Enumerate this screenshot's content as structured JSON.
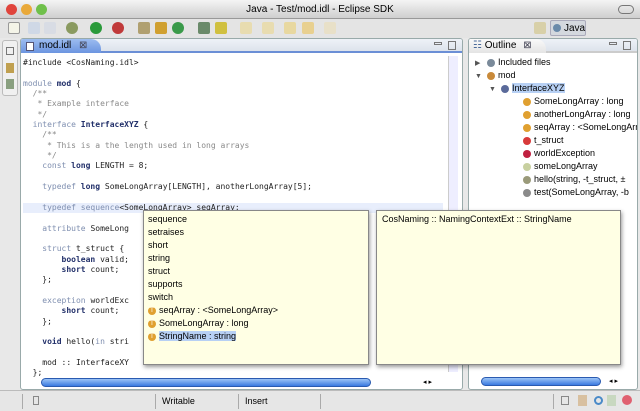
{
  "window": {
    "title": "Java - Test/mod.idl - Eclipse SDK"
  },
  "perspective": {
    "label": "Java"
  },
  "editor": {
    "tab_label": "mod.idl",
    "lines": [
      [
        [
          "",
          "#include <CosNaming.idl>"
        ]
      ],
      [],
      [
        [
          "kw",
          "module"
        ],
        [
          "bd",
          " mod"
        ],
        [
          "",
          " {"
        ]
      ],
      [
        [
          "cm",
          "  /**"
        ]
      ],
      [
        [
          "cm",
          "   * Example interface"
        ]
      ],
      [
        [
          "cm",
          "   */"
        ]
      ],
      [
        [
          "kw",
          "  interface"
        ],
        [
          "bd",
          " InterfaceXYZ"
        ],
        [
          "",
          " {"
        ]
      ],
      [
        [
          "cm",
          "    /**"
        ]
      ],
      [
        [
          "cm",
          "     * This is a the length used in long arrays"
        ]
      ],
      [
        [
          "cm",
          "     */"
        ]
      ],
      [
        [
          "kw",
          "    const"
        ],
        [
          "bd",
          " long"
        ],
        [
          "",
          " LENGTH = 8;"
        ]
      ],
      [],
      [
        [
          "kw",
          "    typedef"
        ],
        [
          "bd",
          " long"
        ],
        [
          "",
          " SomeLongArray[LENGTH], anotherLongArray[5];"
        ]
      ],
      [],
      [
        [
          "kw",
          "    typedef sequence"
        ],
        [
          "",
          "<SomeLongArray> seqArray;"
        ]
      ],
      [],
      [
        [
          "kw",
          "    attribute"
        ],
        [
          "",
          " SomeLong"
        ]
      ],
      [],
      [
        [
          "kw",
          "    struct"
        ],
        [
          "",
          " t_struct {"
        ]
      ],
      [
        [
          "bd",
          "        boolean"
        ],
        [
          "",
          " valid;"
        ]
      ],
      [
        [
          "bd",
          "        short"
        ],
        [
          "",
          " count;"
        ]
      ],
      [
        [
          "",
          "    };"
        ]
      ],
      [],
      [
        [
          "kw",
          "    exception"
        ],
        [
          "",
          " worldExc"
        ]
      ],
      [
        [
          "bd",
          "        short"
        ],
        [
          "",
          " count;"
        ]
      ],
      [
        [
          "",
          "    };"
        ]
      ],
      [],
      [
        [
          "bd",
          "    void"
        ],
        [
          "",
          " hello("
        ],
        [
          "kw",
          "in"
        ],
        [
          "",
          " stri"
        ]
      ],
      [],
      [
        [
          "",
          "    mod :: InterfaceXY"
        ]
      ],
      [
        [
          "",
          "  };"
        ]
      ]
    ]
  },
  "completion": {
    "items": [
      {
        "label": "sequence",
        "icon": ""
      },
      {
        "label": "setraises",
        "icon": ""
      },
      {
        "label": "short",
        "icon": ""
      },
      {
        "label": "string",
        "icon": ""
      },
      {
        "label": "struct",
        "icon": ""
      },
      {
        "label": "supports",
        "icon": ""
      },
      {
        "label": "switch",
        "icon": ""
      },
      {
        "label": "seqArray : <SomeLongArray>",
        "icon": "typedef-icon"
      },
      {
        "label": "SomeLongArray : long",
        "icon": "typedef-icon"
      },
      {
        "label": "StringName : string",
        "icon": "typedef-icon",
        "selected": true
      }
    ],
    "doc": "CosNaming :: NamingContextExt :: StringName"
  },
  "outline": {
    "title": "Outline",
    "items": [
      {
        "label": "Included files",
        "depth": 0,
        "arrow": "▶",
        "icon": "include-icon",
        "color": "#7a8a9a"
      },
      {
        "label": "mod",
        "depth": 0,
        "arrow": "▼",
        "icon": "module-icon",
        "color": "#c98a3a"
      },
      {
        "label": "InterfaceXYZ",
        "depth": 1,
        "arrow": "▼",
        "icon": "interface-icon",
        "color": "#5a6a9a",
        "selected": true
      },
      {
        "label": "SomeLongArray : long",
        "depth": 2,
        "icon": "typedef-icon",
        "color": "#e0a030"
      },
      {
        "label": "anotherLongArray : long",
        "depth": 2,
        "icon": "typedef-icon",
        "color": "#e0a030"
      },
      {
        "label": "seqArray : <SomeLongArray>",
        "depth": 2,
        "icon": "typedef-icon",
        "color": "#e0a030"
      },
      {
        "label": "t_struct",
        "depth": 2,
        "icon": "struct-icon",
        "color": "#d83a3a"
      },
      {
        "label": "worldException",
        "depth": 2,
        "icon": "exception-icon",
        "color": "#c02040"
      },
      {
        "label": "someLongArray",
        "depth": 2,
        "icon": "attribute-icon",
        "color": "#c8d0a0"
      },
      {
        "label": "hello(string, -t_struct, ±",
        "depth": 2,
        "icon": "operation-icon",
        "color": "#9a9a7a"
      },
      {
        "label": "test(SomeLongArray, -b",
        "depth": 2,
        "icon": "operation-icon",
        "color": "#8a8a8a"
      }
    ]
  },
  "status": {
    "writable": "Writable",
    "insert": "Insert"
  },
  "colors": {
    "accent": "#6c95e0",
    "popup_bg": "#ffffe4",
    "selection": "#b7d0f4"
  }
}
